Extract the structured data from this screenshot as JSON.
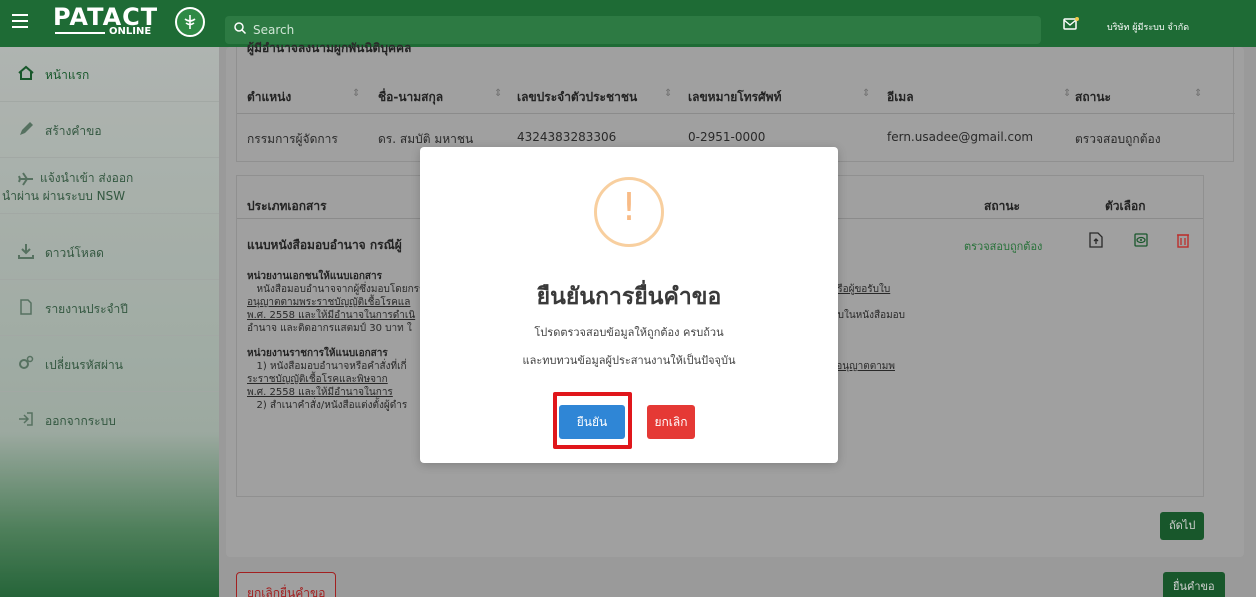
{
  "header": {
    "logo_text": "PATACT",
    "logo_sub": "ONLINE",
    "search_placeholder": "Search",
    "company": "บริษัท ผู้มีระบบ จำกัด"
  },
  "sidebar": {
    "items": [
      {
        "label": "หน้าแรก",
        "icon": "home-icon"
      },
      {
        "label": "สร้างคำขอ",
        "icon": "pen-icon"
      },
      {
        "label": "แจ้งนำเข้า ส่งออก",
        "label2": "นำผ่าน ผ่านระบบ NSW",
        "icon": "plane-icon"
      },
      {
        "label": "ดาวน์โหลด",
        "icon": "download-icon"
      },
      {
        "label": "รายงานประจำปี",
        "icon": "file-icon"
      },
      {
        "label": "เปลี่ยนรหัสผ่าน",
        "icon": "cogs-icon"
      },
      {
        "label": "ออกจากระบบ",
        "icon": "logout-icon"
      }
    ]
  },
  "contacts": {
    "clipped_title": "ผู้มีอำนาจลงนามผูกพันนิติบุคคล",
    "headers": [
      "ตำแหน่ง",
      "ชื่อ-นามสกุล",
      "เลขประจำตัวประชาชน",
      "เลขหมายโทรศัพท์",
      "อีเมล",
      "สถานะ"
    ],
    "row": [
      "กรรมการผู้จัดการ",
      "ดร. สมบัติ มหาชน",
      "4324383283306",
      "0-2951-0000",
      "fern.usadee@gmail.com",
      "ตรวจสอบถูกต้อง"
    ]
  },
  "documents": {
    "headers": {
      "type": "ประเภทเอกสาร",
      "status": "สถานะ",
      "options": "ตัวเลือก"
    },
    "row": {
      "name": "แนบหนังสือมอบอำนาจ กรณีผู้",
      "status": "ตรวจสอบถูกต้อง"
    },
    "private_heading": "หน่วยงานเอกชนให้แนบเอกสาร",
    "private_l1": "หนังสือมอบอำนาจจากผู้ซึ่งมอบโดยกรรม",
    "private_l2": "อนุญาตตามพระราชบัญญัติเชื้อโรคแล",
    "private_l3": "พ.ศ. 2558 และให้มีอำนาจในการดำเนิ",
    "private_l4": "อำนาจ และติดอากรแสตมป์ 30 บาท ใ",
    "private_r1": "าหรือผู้ขอรับใบ",
    "private_r3": "มอบในหนังสือมอบ",
    "gov_heading": "หน่วยงานราชการให้แนบเอกสาร",
    "gov_l1": "1) หนังสือมอบอำนาจหรือคำสั่งที่เกี่",
    "gov_l2": "ระราชบัญญัติเชื้อโรคและพิษจาก",
    "gov_l3": "พ.ศ. 2558 และให้มีอำนาจในการ",
    "gov_l4": "2) สำเนาคำสั่ง/หนังสือแต่งตั้งผู้ดำร",
    "gov_r1": "ใบอนุญาตตามพ"
  },
  "buttons": {
    "next": "ถัดไป",
    "cancel_request": "ยกเลิกยื่นคำขอ",
    "submit_request": "ยื่นคำขอ"
  },
  "modal": {
    "icon": "!",
    "title": "ยืนยันการยื่นคำขอ",
    "line1": "โปรดตรวจสอบข้อมูลให้ถูกต้อง ครบถ้วน",
    "line2": "และทบทวนข้อมูลผู้ประสานงานให้เป็นปัจจุบัน",
    "confirm": "ยืนยัน",
    "cancel": "ยกเลิก"
  },
  "colors": {
    "brand": "#1e6b35",
    "confirm": "#2f86d6",
    "danger": "#e53935",
    "highlight": "#e0161b",
    "warning": "#f8bb86"
  }
}
